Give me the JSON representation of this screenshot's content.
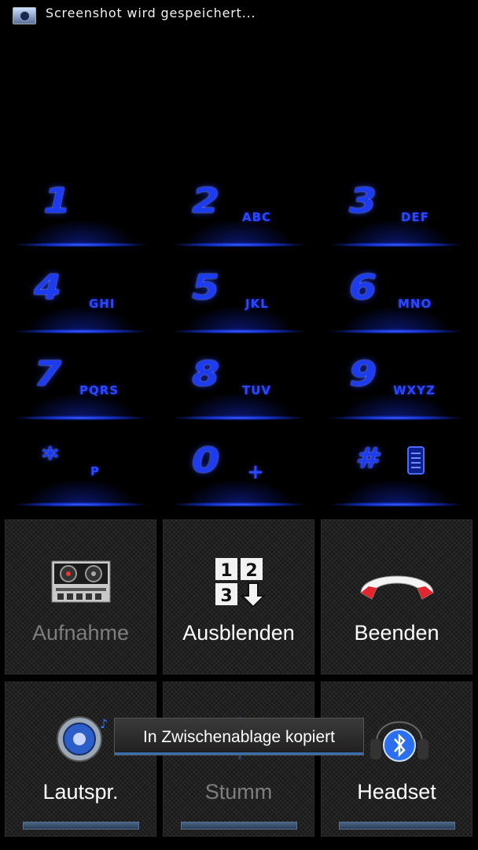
{
  "status_bar": {
    "notification_text": "Screenshot wird gespeichert...",
    "icon": "screenshot-icon"
  },
  "dialpad": {
    "keys": [
      {
        "digit": "1",
        "letters": ""
      },
      {
        "digit": "2",
        "letters": "ABC"
      },
      {
        "digit": "3",
        "letters": "DEF"
      },
      {
        "digit": "4",
        "letters": "GHI"
      },
      {
        "digit": "5",
        "letters": "JKL"
      },
      {
        "digit": "6",
        "letters": "MNO"
      },
      {
        "digit": "7",
        "letters": "PQRS"
      },
      {
        "digit": "8",
        "letters": "TUV"
      },
      {
        "digit": "9",
        "letters": "WXYZ"
      },
      {
        "digit": "*",
        "letters": "P"
      },
      {
        "digit": "0",
        "letters": "+"
      },
      {
        "digit": "#",
        "letters": ""
      }
    ],
    "accent_color": "#1d3cf0"
  },
  "call_controls": {
    "record": {
      "label": "Aufnahme",
      "icon": "tape-recorder-icon",
      "enabled": false
    },
    "hide_dialpad": {
      "label": "Ausblenden",
      "icon": "dialpad-icon",
      "enabled": true
    },
    "end_call": {
      "label": "Beenden",
      "icon": "hang-up-icon",
      "enabled": true
    },
    "speaker": {
      "label": "Lautspr.",
      "icon": "speaker-icon",
      "enabled": true
    },
    "mute": {
      "label": "Stumm",
      "icon": "microphone-icon",
      "enabled": false
    },
    "headset": {
      "label": "Headset",
      "icon": "bluetooth-headset-icon",
      "enabled": true
    }
  },
  "toast": {
    "text": "In Zwischenablage kopiert"
  }
}
